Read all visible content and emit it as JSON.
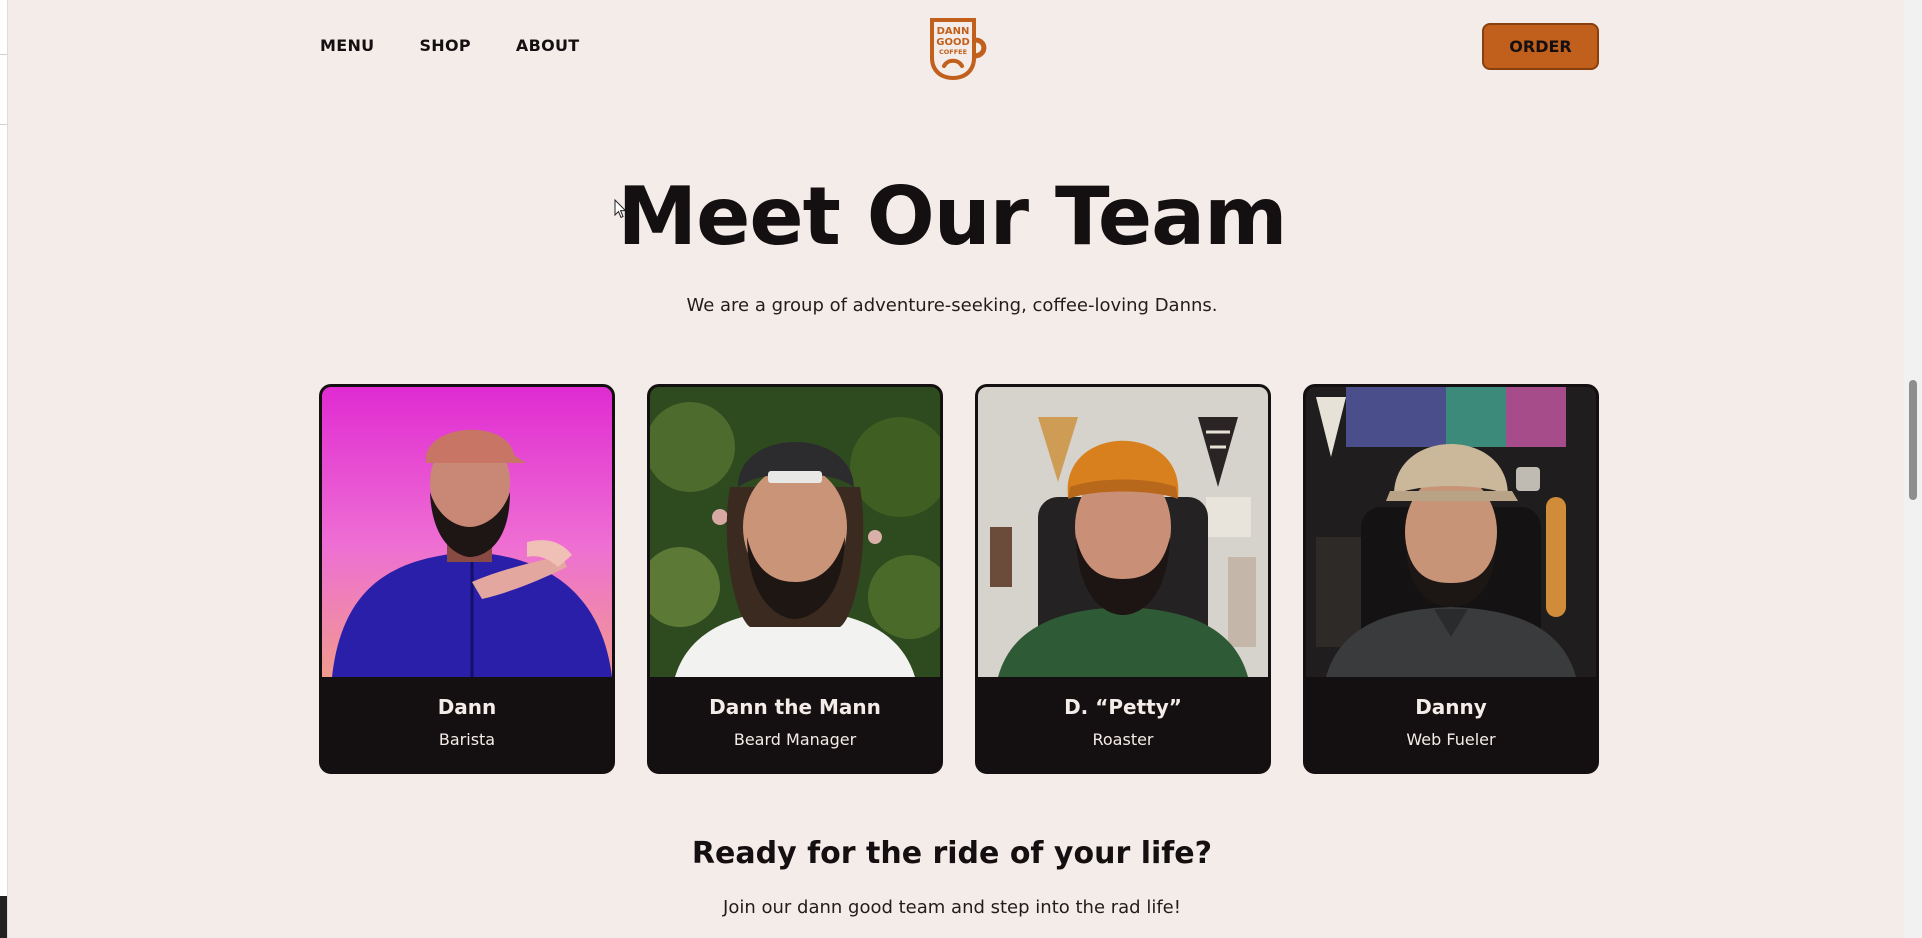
{
  "nav": {
    "links": [
      "MENU",
      "SHOP",
      "ABOUT"
    ],
    "order_label": "ORDER"
  },
  "logo": {
    "line1": "DANN",
    "line2": "GOOD",
    "line3": "COFFEE"
  },
  "hero": {
    "title": "Meet Our Team",
    "subtitle": "We are a group of adventure-seeking, coffee-loving Danns."
  },
  "team": [
    {
      "name": "Dann",
      "role": "Barista"
    },
    {
      "name": "Dann the Mann",
      "role": "Beard Manager"
    },
    {
      "name": "D. “Petty”",
      "role": "Roaster"
    },
    {
      "name": "Danny",
      "role": "Web Fueler"
    }
  ],
  "cta": {
    "title": "Ready for the ride of your life?",
    "text": "Join our dann good team and step into the rad life!"
  },
  "colors": {
    "background": "#f4ece8",
    "ink": "#140f10",
    "accent": "#c15f1c"
  }
}
